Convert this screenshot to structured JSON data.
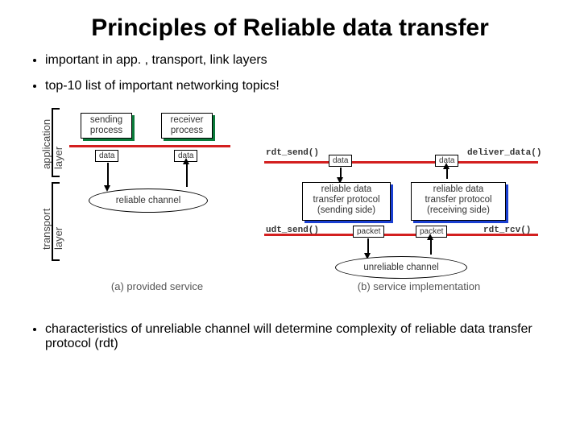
{
  "title": "Principles of Reliable data transfer",
  "bullets": [
    "important in app. , transport, link layers",
    "top-10 list of important networking topics!",
    "characteristics of unreliable channel will determine complexity of reliable data transfer protocol (rdt)"
  ],
  "diagram": {
    "layers": {
      "application": "application\nlayer",
      "transport": "transport\nlayer"
    },
    "left": {
      "sender": "sending\nprocess",
      "receiver": "receiver\nprocess",
      "data": "data",
      "channel": "reliable channel"
    },
    "right": {
      "sender_proto": "reliable data\ntransfer protocol\n(sending side)",
      "receiver_proto": "reliable data\ntransfer protocol\n(receiving side)",
      "data": "data",
      "packet": "packet",
      "channel": "unreliable channel",
      "fn_rdt_send": "rdt_send()",
      "fn_deliver": "deliver_data()",
      "fn_udt_send": "udt_send()",
      "fn_rdt_rcv": "rdt_rcv()"
    },
    "captions": {
      "a": "(a)   provided service",
      "b": "(b)  service implementation"
    }
  }
}
